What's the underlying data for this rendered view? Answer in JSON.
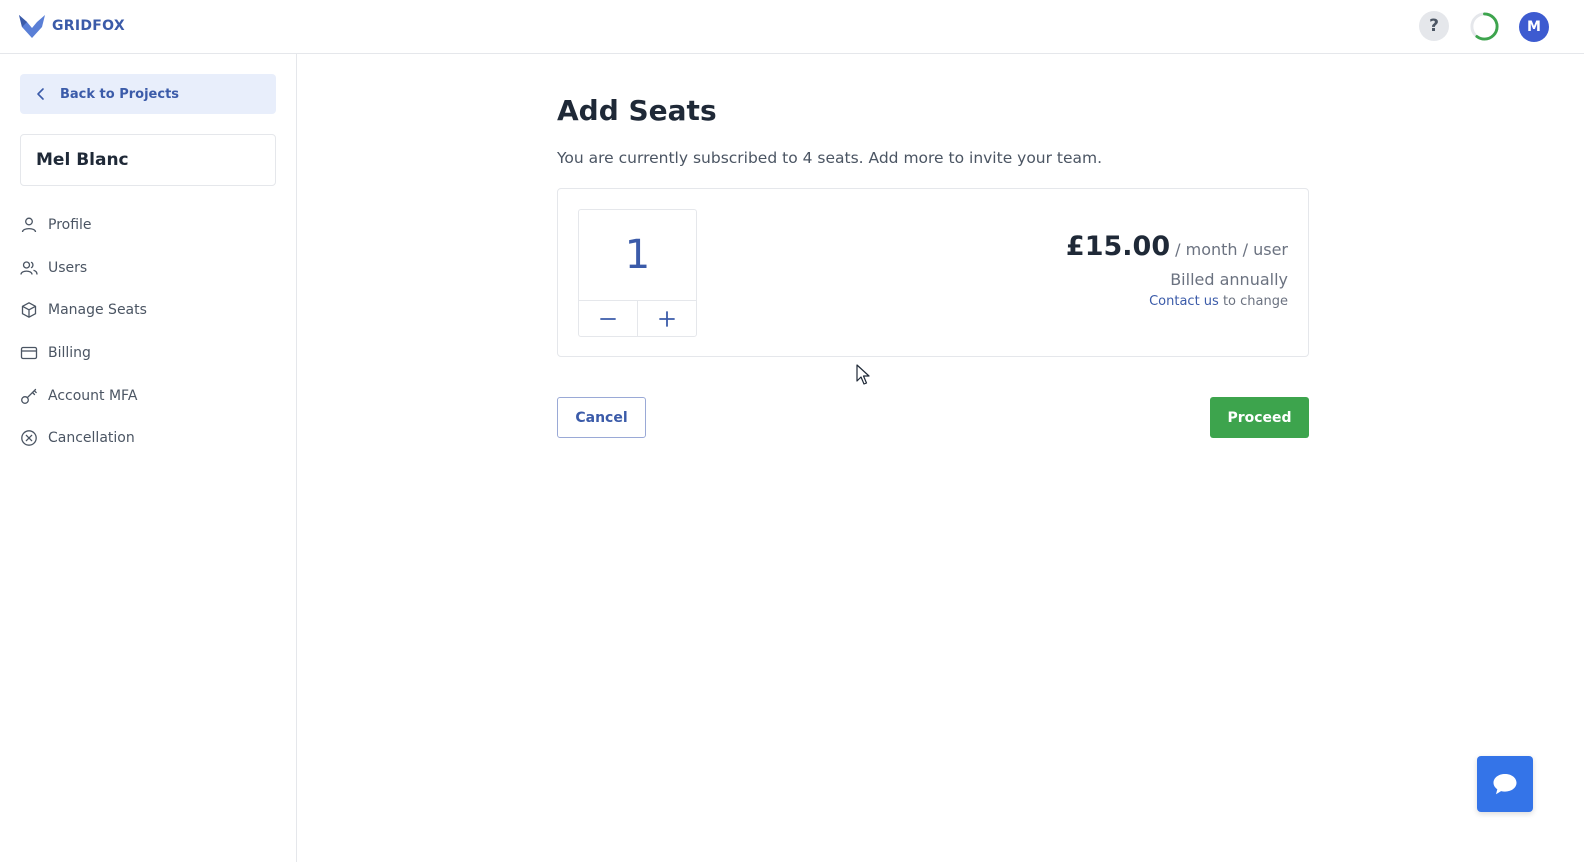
{
  "header": {
    "brand": "GRIDFOX",
    "help_label": "?",
    "avatar_initial": "M",
    "progress_fraction": 0.6,
    "colors": {
      "brand": "#3b5ba9",
      "progress": "#3da44d",
      "avatar": "#3d5bd0"
    }
  },
  "sidebar": {
    "back_label": "Back to Projects",
    "account_name": "Mel Blanc",
    "items": [
      {
        "label": "Profile",
        "icon": "user-icon"
      },
      {
        "label": "Users",
        "icon": "users-icon"
      },
      {
        "label": "Manage Seats",
        "icon": "box-icon"
      },
      {
        "label": "Billing",
        "icon": "credit-card-icon"
      },
      {
        "label": "Account MFA",
        "icon": "key-icon"
      },
      {
        "label": "Cancellation",
        "icon": "x-circle-icon"
      }
    ]
  },
  "main": {
    "title": "Add Seats",
    "subtitle": "You are currently subscribed to 4 seats. Add more to invite your team.",
    "stepper": {
      "value": "1"
    },
    "pricing": {
      "price": "£15.00",
      "unit": "/ month / user",
      "billing": "Billed annually",
      "contact_link": "Contact us",
      "contact_suffix": " to change"
    },
    "cancel_label": "Cancel",
    "proceed_label": "Proceed",
    "colors": {
      "proceed": "#3da44d",
      "chat": "#3474e8"
    }
  }
}
